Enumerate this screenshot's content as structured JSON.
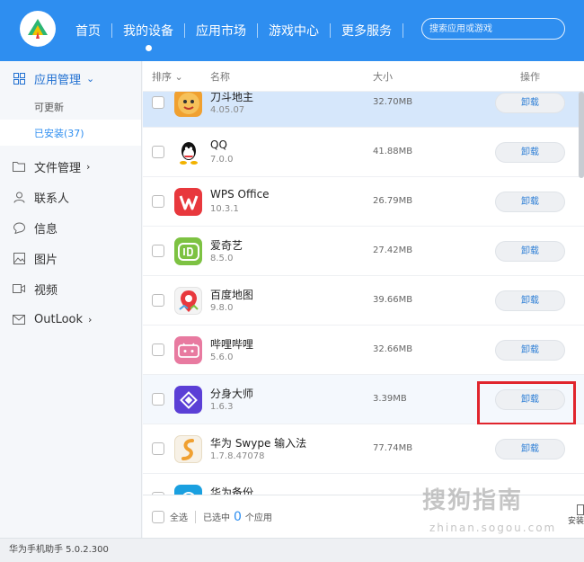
{
  "topbar": {
    "nav": [
      "首页",
      "我的设备",
      "应用市场",
      "游戏中心",
      "更多服务"
    ],
    "active_index": 1,
    "search_placeholder": "搜索应用或游戏"
  },
  "sidebar": {
    "app_mgmt": "应用管理",
    "updatable": "可更新",
    "installed": "已安装(37)",
    "file_mgmt": "文件管理",
    "contacts": "联系人",
    "messages": "信息",
    "photos": "图片",
    "videos": "视频",
    "outlook": "OutLook"
  },
  "table": {
    "col_sort": "排序",
    "col_name": "名称",
    "col_size": "大小",
    "col_action": "操作",
    "rows": [
      {
        "name": "刀斗地主",
        "version": "4.05.07",
        "size": "32.70MB",
        "action": "卸载",
        "icon": "doudizhu-icon",
        "color": "#f0a030"
      },
      {
        "name": "QQ",
        "version": "7.0.0",
        "size": "41.88MB",
        "action": "卸载",
        "icon": "qq-icon",
        "color": "#ffffff"
      },
      {
        "name": "WPS Office",
        "version": "10.3.1",
        "size": "26.79MB",
        "action": "卸载",
        "icon": "wps-icon",
        "color": "#e8383d"
      },
      {
        "name": "爱奇艺",
        "version": "8.5.0",
        "size": "27.42MB",
        "action": "卸载",
        "icon": "iqiyi-icon",
        "color": "#7dc242"
      },
      {
        "name": "百度地图",
        "version": "9.8.0",
        "size": "39.66MB",
        "action": "卸载",
        "icon": "baidumap-icon",
        "color": "#ffffff"
      },
      {
        "name": "哔哩哔哩",
        "version": "5.6.0",
        "size": "32.66MB",
        "action": "卸载",
        "icon": "bilibili-icon",
        "color": "#e87aa0"
      },
      {
        "name": "分身大师",
        "version": "1.6.3",
        "size": "3.39MB",
        "action": "卸载",
        "icon": "fenshen-icon",
        "color": "#5b3fd6"
      },
      {
        "name": "华为 Swype 输入法",
        "version": "1.7.8.47078",
        "size": "77.74MB",
        "action": "卸载",
        "icon": "swype-icon",
        "color": "#f0a030"
      },
      {
        "name": "华为备份",
        "version": "",
        "size": "",
        "action": "",
        "icon": "backup-icon",
        "color": "#1aa0e0"
      }
    ]
  },
  "footer": {
    "select_all": "全选",
    "selected_prefix": "已选中",
    "selected_count": "0",
    "selected_suffix": "个应用",
    "right_label": "安装"
  },
  "status": {
    "version": "华为手机助手 5.0.2.300"
  },
  "watermark": {
    "text": "搜狗指南",
    "url": "zhinan.sogou.com"
  }
}
